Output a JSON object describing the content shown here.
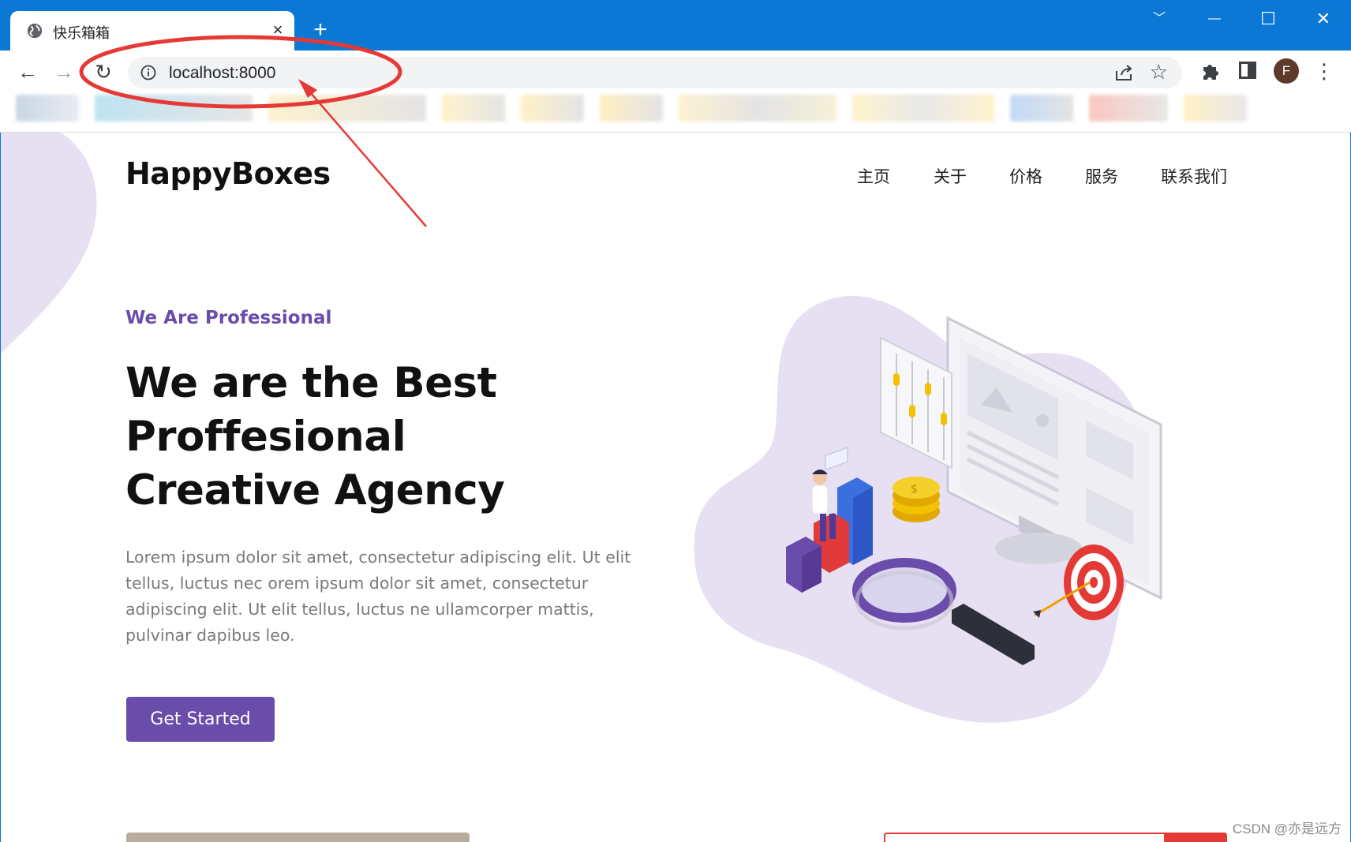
{
  "browser": {
    "tab_title": "快乐箱箱",
    "tab_close": "×",
    "new_tab": "+",
    "url": "localhost:8000",
    "profile_initial": "F",
    "window_controls": {
      "collapse": "﹀",
      "minimize": "—",
      "maximize": "☐",
      "close": "✕"
    },
    "nav": {
      "back": "←",
      "forward": "→",
      "reload": "↻"
    },
    "star": "☆",
    "menu": "⋮"
  },
  "site": {
    "brand": "HappyBoxes",
    "nav_links": [
      "主页",
      "关于",
      "价格",
      "服务",
      "联系我们"
    ],
    "hero": {
      "kicker": "We Are Professional",
      "headline_lines": [
        "We are the Best",
        "Proffesional",
        "Creative Agency"
      ],
      "lede": "Lorem ipsum dolor sit amet, consectetur adipiscing elit. Ut elit tellus, luctus nec orem ipsum dolor sit amet, consectetur adipiscing elit. Ut elit tellus, luctus ne ullamcorper mattis, pulvinar dapibus leo.",
      "cta_label": "Get Started"
    }
  },
  "colors": {
    "chrome_blue": "#0a78d4",
    "accent_purple": "#6a4cab",
    "blob_lilac": "#e7e0f3",
    "annotation_red": "#e53935"
  },
  "icons": [
    "globe-icon",
    "info-icon",
    "share-icon",
    "star-icon",
    "puzzle-icon",
    "side-panel-icon",
    "menu-icon"
  ],
  "watermark": "CSDN @亦是远方"
}
